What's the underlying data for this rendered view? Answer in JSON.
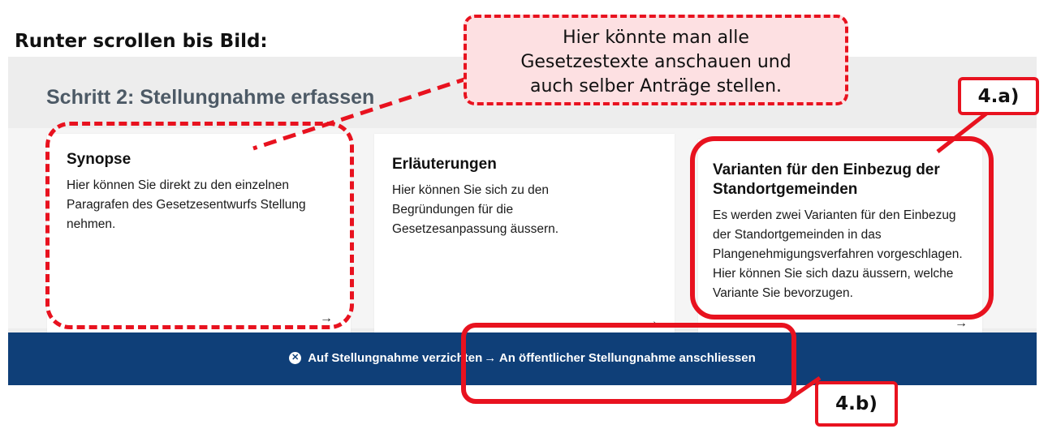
{
  "page": {
    "heading": "Runter scrollen bis Bild:"
  },
  "screenshot": {
    "step_title": "Schritt 2: Stellungnahme erfassen",
    "cards": [
      {
        "title": "Synopse",
        "text": "Hier können Sie direkt zu den einzelnen Paragrafen des Gesetzesentwurfs Stellung nehmen.",
        "arrow": "→"
      },
      {
        "title": "Erläuterungen",
        "text": "Hier können Sie sich zu den Begründungen für die Gesetzesanpassung äussern.",
        "arrow": "→"
      },
      {
        "title": "Varianten für den Einbezug der Standortgemeinden",
        "text": "Es werden zwei Varianten für den Einbezug der Standortgemeinden in das Plangenehmigungsverfahren vorgeschlagen. Hier können Sie sich dazu äussern, welche Variante Sie bevorzugen.",
        "arrow": "→"
      }
    ],
    "bottom_bar": {
      "decline_icon": "x-circle-icon",
      "decline_label": "Auf Stellungnahme verzichten",
      "join_icon": "arrow-right-icon",
      "join_label": "→ An öffentlicher Stellungnahme anschliessen"
    }
  },
  "annotations": {
    "callout_lines": [
      "Hier könnte man alle",
      "Gesetzestexte anschauen und",
      "auch selber Anträge stellen."
    ],
    "label_a": "4.a)",
    "label_b": "4.b)"
  },
  "colors": {
    "annotation_red": "#e8121f",
    "callout_fill": "#fde0e2",
    "bar_blue": "#0f3f78",
    "step_title_gray": "#4d5a66"
  }
}
